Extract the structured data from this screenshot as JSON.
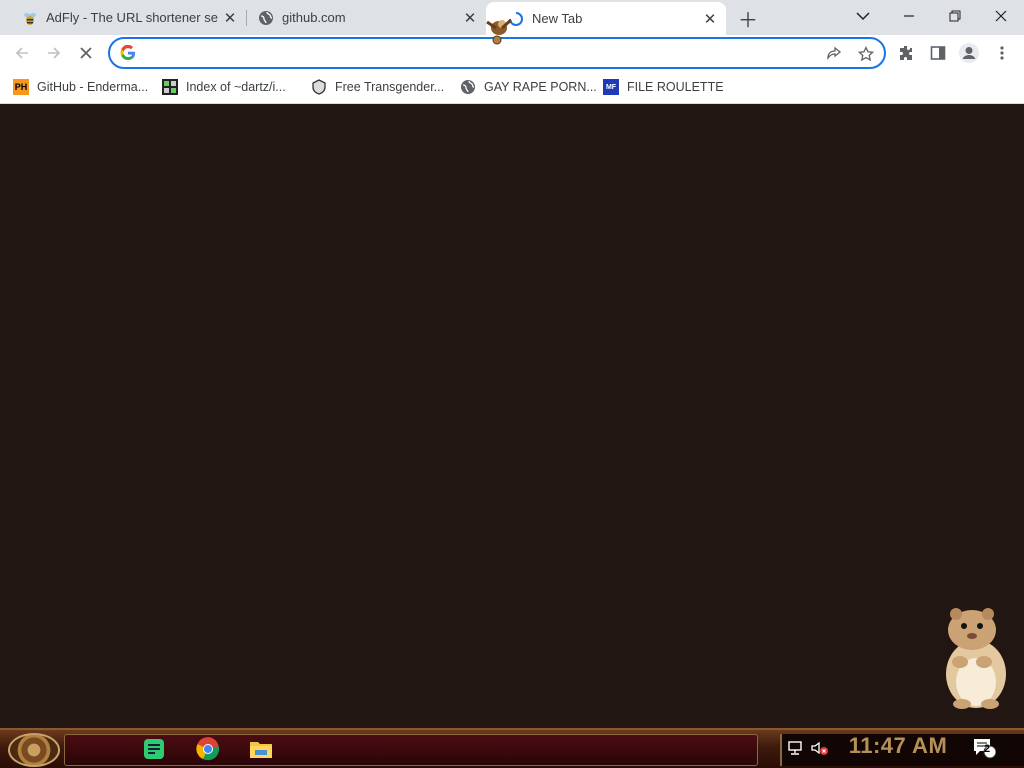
{
  "tabs": [
    {
      "title": "AdFly - The URL shortener se",
      "favicon": "adfly-icon",
      "active": false
    },
    {
      "title": "github.com",
      "favicon": "globe-icon",
      "active": false
    },
    {
      "title": "New Tab",
      "favicon": "loading-spinner-icon",
      "active": true
    }
  ],
  "omnibox": {
    "value": "",
    "placeholder": ""
  },
  "bookmarks": [
    {
      "label": "GitHub - Enderma...",
      "icon_text": "PH"
    },
    {
      "label": "Index of ~dartz/i...",
      "icon_text": ""
    },
    {
      "label": "Free Transgender...",
      "icon_text": ""
    },
    {
      "label": "GAY RAPE PORN...",
      "icon_text": ""
    },
    {
      "label": "FILE ROULETTE",
      "icon_text": "MF"
    }
  ],
  "taskbar": {
    "clock": "11:47 AM",
    "notification_count": "2"
  },
  "colors": {
    "accent": "#1a73e8",
    "page_bg": "#211611",
    "clock": "#b59058"
  }
}
